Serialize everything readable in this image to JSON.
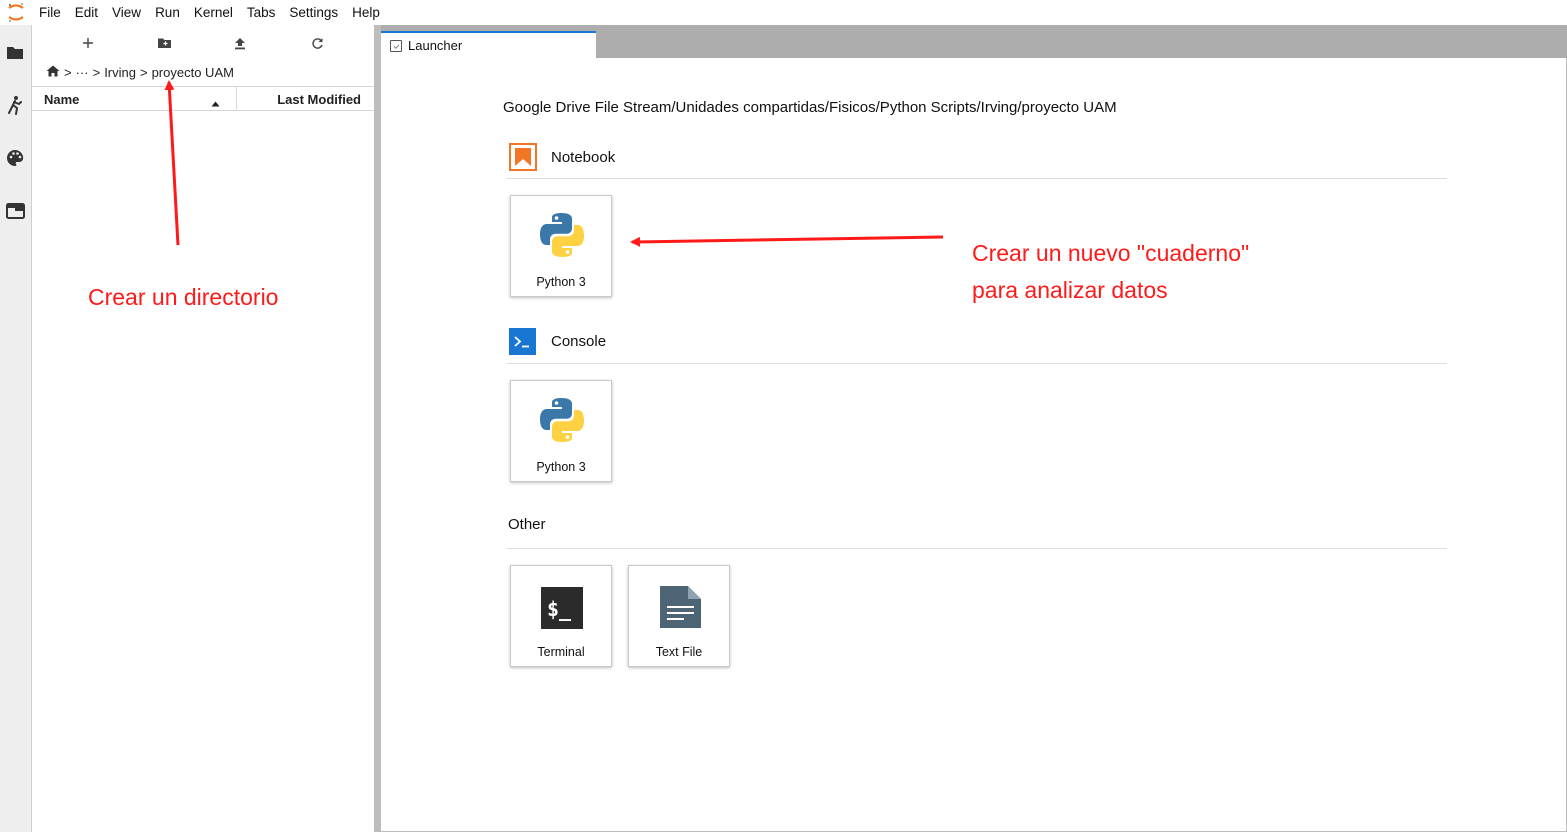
{
  "menubar": {
    "items": [
      "File",
      "Edit",
      "View",
      "Run",
      "Kernel",
      "Tabs",
      "Settings",
      "Help"
    ]
  },
  "activitybar": {
    "icons": [
      "folder-icon",
      "running-icon",
      "palette-icon",
      "tabs-icon"
    ]
  },
  "filebrowser": {
    "breadcrumb": {
      "ellipsis": "···",
      "parent": "Irving",
      "current": "proyecto UAM",
      "separator": ">"
    },
    "columns": {
      "name": "Name",
      "modified": "Last Modified"
    }
  },
  "tabs": [
    {
      "label": "Launcher"
    }
  ],
  "launcher": {
    "cwd": "Google Drive File Stream/Unidades compartidas/Fisicos/Python Scripts/Irving/proyecto UAM",
    "sections": {
      "notebook": {
        "title": "Notebook",
        "cards": [
          "Python 3"
        ]
      },
      "console": {
        "title": "Console",
        "cards": [
          "Python 3"
        ]
      },
      "other": {
        "title": "Other",
        "cards": [
          "Terminal",
          "Text File"
        ]
      }
    }
  },
  "annotations": {
    "directory": "Crear un directorio",
    "notebook_line1": "Crear un nuevo \"cuaderno\"",
    "notebook_line2": "para analizar datos",
    "color": "#ff1a1a"
  },
  "colors": {
    "accent": "#1976d2",
    "notebook_icon": "#f37626",
    "console_icon": "#1976d2",
    "terminal_icon": "#2b2b2b",
    "textfile_icon": "#4d6474"
  }
}
